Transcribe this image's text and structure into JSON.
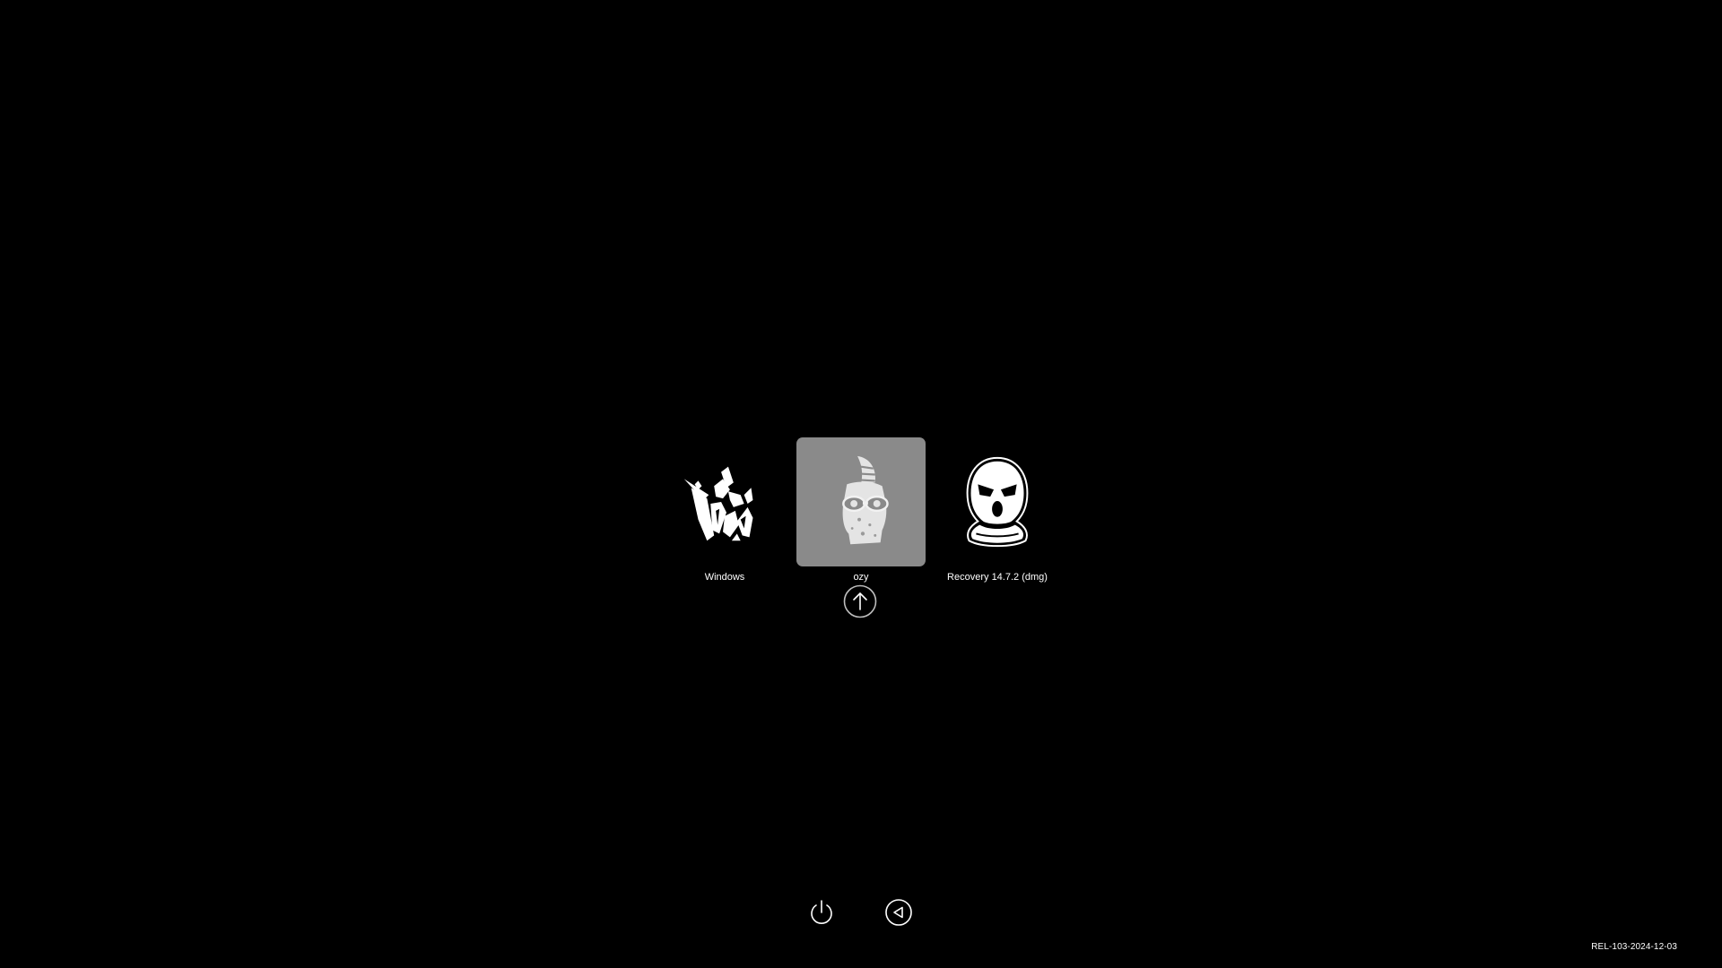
{
  "boot_picker": {
    "entries": [
      {
        "label": "Windows",
        "icon": "shattered-figure-icon",
        "selected": false
      },
      {
        "label": "ozy",
        "icon": "horned-goggles-figure-icon",
        "selected": true
      },
      {
        "label": "Recovery 14.7.2 (dmg)",
        "icon": "balaclava-mask-icon",
        "selected": false
      }
    ],
    "boot_button_icon": "up-arrow-circle-icon"
  },
  "controls": {
    "shutdown_icon": "power-icon",
    "restart_icon": "restart-triangle-icon"
  },
  "version_text": "REL-103-2024-12-03",
  "colors": {
    "background": "#000000",
    "selection": "#8a8a8a",
    "text": "#ffffff"
  }
}
